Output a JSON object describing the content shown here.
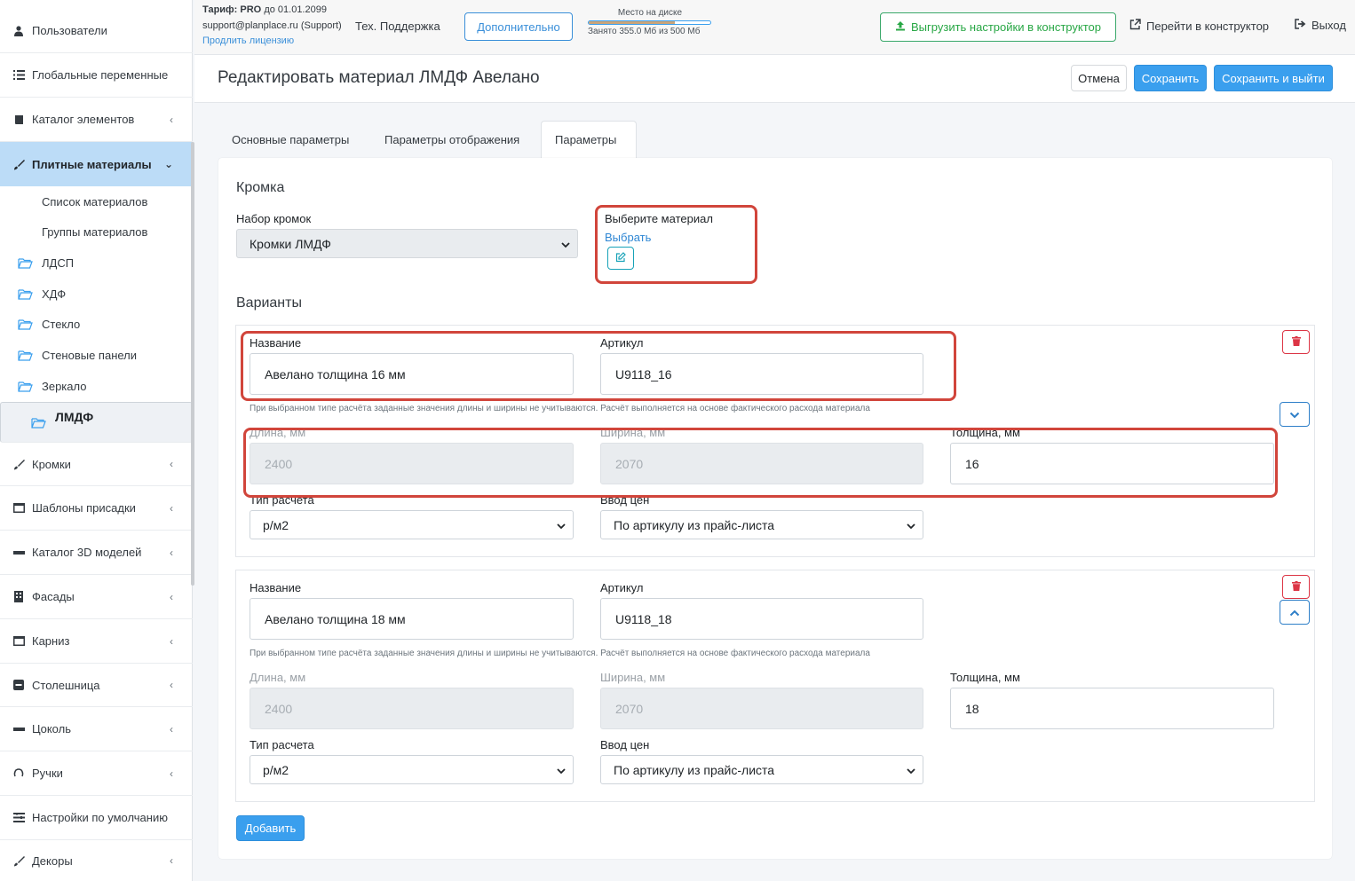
{
  "sidebar": {
    "items": [
      {
        "label": "Пользователи",
        "icon": "user-icon"
      },
      {
        "label": "Глобальные переменные",
        "icon": "list-icon"
      },
      {
        "label": "Каталог элементов",
        "icon": "book-icon"
      },
      {
        "label": "Плитные материалы",
        "icon": "brush-icon"
      }
    ],
    "sub_items": [
      "Список материалов",
      "Группы материалов"
    ],
    "folders": [
      "ЛДСП",
      "ХДФ",
      "Стекло",
      "Стеновые панели",
      "Зеркало",
      "ЛМДФ"
    ],
    "items2": [
      {
        "label": "Кромки",
        "icon": "brush-icon"
      },
      {
        "label": "Шаблоны присадки",
        "icon": "window-icon"
      },
      {
        "label": "Каталог 3D моделей",
        "icon": "minus-icon"
      },
      {
        "label": "Фасады",
        "icon": "building-icon"
      },
      {
        "label": "Карниз",
        "icon": "window-icon"
      },
      {
        "label": "Столешница",
        "icon": "minus-square-icon"
      },
      {
        "label": "Цоколь",
        "icon": "minus-icon"
      },
      {
        "label": "Ручки",
        "icon": "handle-icon"
      },
      {
        "label": "Настройки по умолчанию",
        "icon": "sliders-icon"
      },
      {
        "label": "Декоры",
        "icon": "brush-icon"
      }
    ]
  },
  "topbar": {
    "tariff_label": "Тариф:",
    "tariff_value": "PRO",
    "tariff_until": "до 01.01.2099",
    "email": "support@planplace.ru (Support)",
    "extend_license": "Продлить лицензию",
    "support": "Тех. Поддержка",
    "additional": "Дополнительно",
    "disk_title": "Место на диске",
    "disk_used": "Занято 355.0 Мб из 500 Мб",
    "disk_fraction": 0.71,
    "upload_settings": "Выгрузить настройки в конструктор",
    "go_constructor": "Перейти в конструктор",
    "logout": "Выход"
  },
  "header": {
    "title": "Редактировать материал ЛМДФ Авелано",
    "cancel": "Отмена",
    "save": "Сохранить",
    "save_exit": "Сохранить и выйти"
  },
  "tabs": [
    "Основные параметры",
    "Параметры отображения",
    "Параметры"
  ],
  "edge": {
    "section_title": "Кромка",
    "set_label": "Набор кромок",
    "set_value": "Кромки ЛМДФ",
    "material_label": "Выберите материал",
    "material_link": "Выбрать"
  },
  "variants_title": "Варианты",
  "labels": {
    "name": "Название",
    "article": "Артикул",
    "length": "Длина, мм",
    "width": "Ширина, мм",
    "thickness": "Толщина, мм",
    "calc_type": "Тип расчета",
    "price_input": "Ввод цен",
    "hint": "При выбранном типе расчёта заданные значения длины и ширины не учитываются. Расчёт выполняется на основе фактического расхода материала"
  },
  "variants": [
    {
      "name": "Авелано толщина 16 мм",
      "article": "U9118_16",
      "length": "2400",
      "width": "2070",
      "thickness": "16",
      "calc_type": "р/м2",
      "price_input": "По артикулу из прайс-листа"
    },
    {
      "name": "Авелано толщина 18 мм",
      "article": "U9118_18",
      "length": "2400",
      "width": "2070",
      "thickness": "18",
      "calc_type": "р/м2",
      "price_input": "По артикулу из прайс-листа"
    }
  ],
  "add_button": "Добавить",
  "colors": {
    "accent": "#3a9fee",
    "active_nav": "#bcdcf7",
    "highlight": "#d1453b",
    "danger": "#dc3545",
    "success": "#28a745"
  }
}
